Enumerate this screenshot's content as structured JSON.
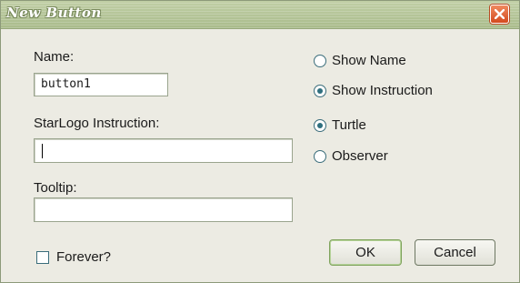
{
  "window": {
    "title": "New Button"
  },
  "form": {
    "name_label": "Name:",
    "name_value": "button1",
    "instruction_label": "StarLogo Instruction:",
    "instruction_value": "",
    "tooltip_label": "Tooltip:",
    "tooltip_value": "",
    "forever_label": "Forever?",
    "forever_checked": false
  },
  "display_options": [
    {
      "label": "Show Name",
      "selected": false
    },
    {
      "label": "Show Instruction",
      "selected": true
    }
  ],
  "agent_options": [
    {
      "label": "Turtle",
      "selected": true
    },
    {
      "label": "Observer",
      "selected": false
    }
  ],
  "buttons": {
    "ok": "OK",
    "cancel": "Cancel"
  },
  "colors": {
    "titlebar": "#b3c496",
    "dialog_bg": "#ecebe3",
    "close": "#e0602f",
    "radio_accent": "#2f6f7f"
  },
  "icons": {
    "close": "close-icon"
  }
}
